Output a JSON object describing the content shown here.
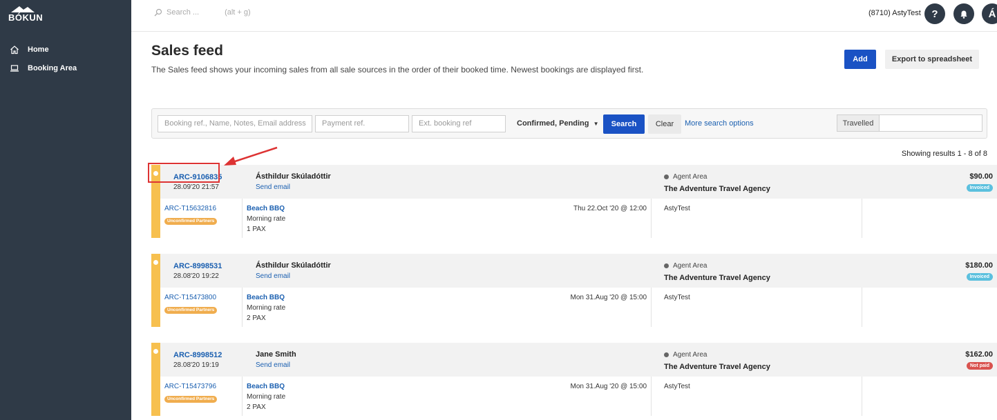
{
  "brand": {
    "name": "BÓKUN"
  },
  "sidebar": {
    "items": [
      {
        "label": "Home",
        "icon": "home-icon"
      },
      {
        "label": "Booking Area",
        "icon": "laptop-icon"
      }
    ]
  },
  "topbar": {
    "search_placeholder": "Search ...",
    "search_shortcut": "(alt + g)",
    "user": "(8710) AstyTest",
    "help_label": "?",
    "avatar_label": "Á"
  },
  "page": {
    "title": "Sales feed",
    "description": "The Sales feed shows your incoming sales from all sale sources in the order of their booked time. Newest bookings are displayed first.",
    "add_label": "Add",
    "export_label": "Export to spreadsheet"
  },
  "filters": {
    "booking_ref_placeholder": "Booking ref., Name, Notes, Email address",
    "payment_ref_placeholder": "Payment ref.",
    "ext_ref_placeholder": "Ext. booking ref",
    "status_label": "Confirmed, Pending",
    "search_label": "Search",
    "clear_label": "Clear",
    "more_label": "More search options",
    "travelled_label": "Travelled"
  },
  "results": {
    "summary": "Showing results 1 - 8 of 8"
  },
  "bookings": [
    {
      "ref": "ARC-9106835",
      "date": "28.09'20 21:57",
      "customer": "Ásthildur Skúladóttir",
      "email_label": "Send email",
      "channel": "Agent Area",
      "agency": "The Adventure Travel Agency",
      "price": "$90.00",
      "payment": "Invoiced",
      "sub_ref": "ARC-T15632816",
      "partner": "Unconfirmed Partners",
      "product": "Beach BBQ",
      "rate": "Morning rate",
      "pax": "1 PAX",
      "when": "Thu 22.Oct '20 @ 12:00",
      "seller": "AstyTest"
    },
    {
      "ref": "ARC-8998531",
      "date": "28.08'20 19:22",
      "customer": "Ásthildur Skúladóttir",
      "email_label": "Send email",
      "channel": "Agent Area",
      "agency": "The Adventure Travel Agency",
      "price": "$180.00",
      "payment": "Invoiced",
      "sub_ref": "ARC-T15473800",
      "partner": "Unconfirmed Partners",
      "product": "Beach BBQ",
      "rate": "Morning rate",
      "pax": "2 PAX",
      "when": "Mon 31.Aug '20 @ 15:00",
      "seller": "AstyTest"
    },
    {
      "ref": "ARC-8998512",
      "date": "28.08'20 19:19",
      "customer": "Jane Smith",
      "email_label": "Send email",
      "channel": "Agent Area",
      "agency": "The Adventure Travel Agency",
      "price": "$162.00",
      "payment": "Not paid",
      "sub_ref": "ARC-T15473796",
      "partner": "Unconfirmed Partners",
      "product": "Beach BBQ",
      "rate": "Morning rate",
      "pax": "2 PAX",
      "when": "Mon 31.Aug '20 @ 15:00",
      "seller": "AstyTest"
    }
  ],
  "colors": {
    "sidebar": "#2f3a47",
    "primary": "#1a52c4",
    "link": "#1a5fb0",
    "pending": "#f7c04f",
    "invoiced": "#5bc0de",
    "not_paid": "#d9534f",
    "partner": "#f0ad4e",
    "annotation": "#dd3333"
  }
}
